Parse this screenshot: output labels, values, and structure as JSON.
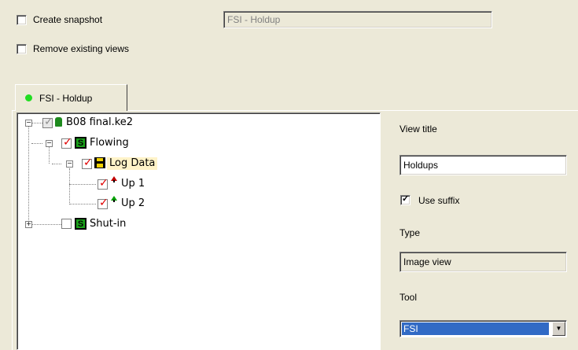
{
  "options": {
    "create_snapshot": {
      "label": "Create snapshot",
      "checked": false
    },
    "remove_existing_views": {
      "label": "Remove existing views",
      "checked": false
    },
    "snapshot_name": "FSI - Holdup"
  },
  "tab": {
    "label": "FSI - Holdup",
    "status_color": "#22DD22"
  },
  "tree": {
    "root": {
      "label": "B08 final.ke2",
      "expander": "−"
    },
    "flowing": {
      "label": "Flowing",
      "icon": "S",
      "expander": "−"
    },
    "log_data": {
      "label": "Log Data",
      "expander": "−"
    },
    "up1": {
      "label": "Up 1",
      "arrow": "up-arrow-red"
    },
    "up2": {
      "label": "Up 2",
      "arrow": "up-arrow-green"
    },
    "shutin": {
      "label": "Shut-in",
      "icon": "S",
      "expander": "+"
    }
  },
  "properties": {
    "view_title_label": "View title",
    "view_title_value": "Holdups",
    "use_suffix": {
      "label": "Use suffix",
      "checked": true
    },
    "type_label": "Type",
    "type_value": "Image view",
    "tool_label": "Tool",
    "tool_value": "FSI"
  }
}
